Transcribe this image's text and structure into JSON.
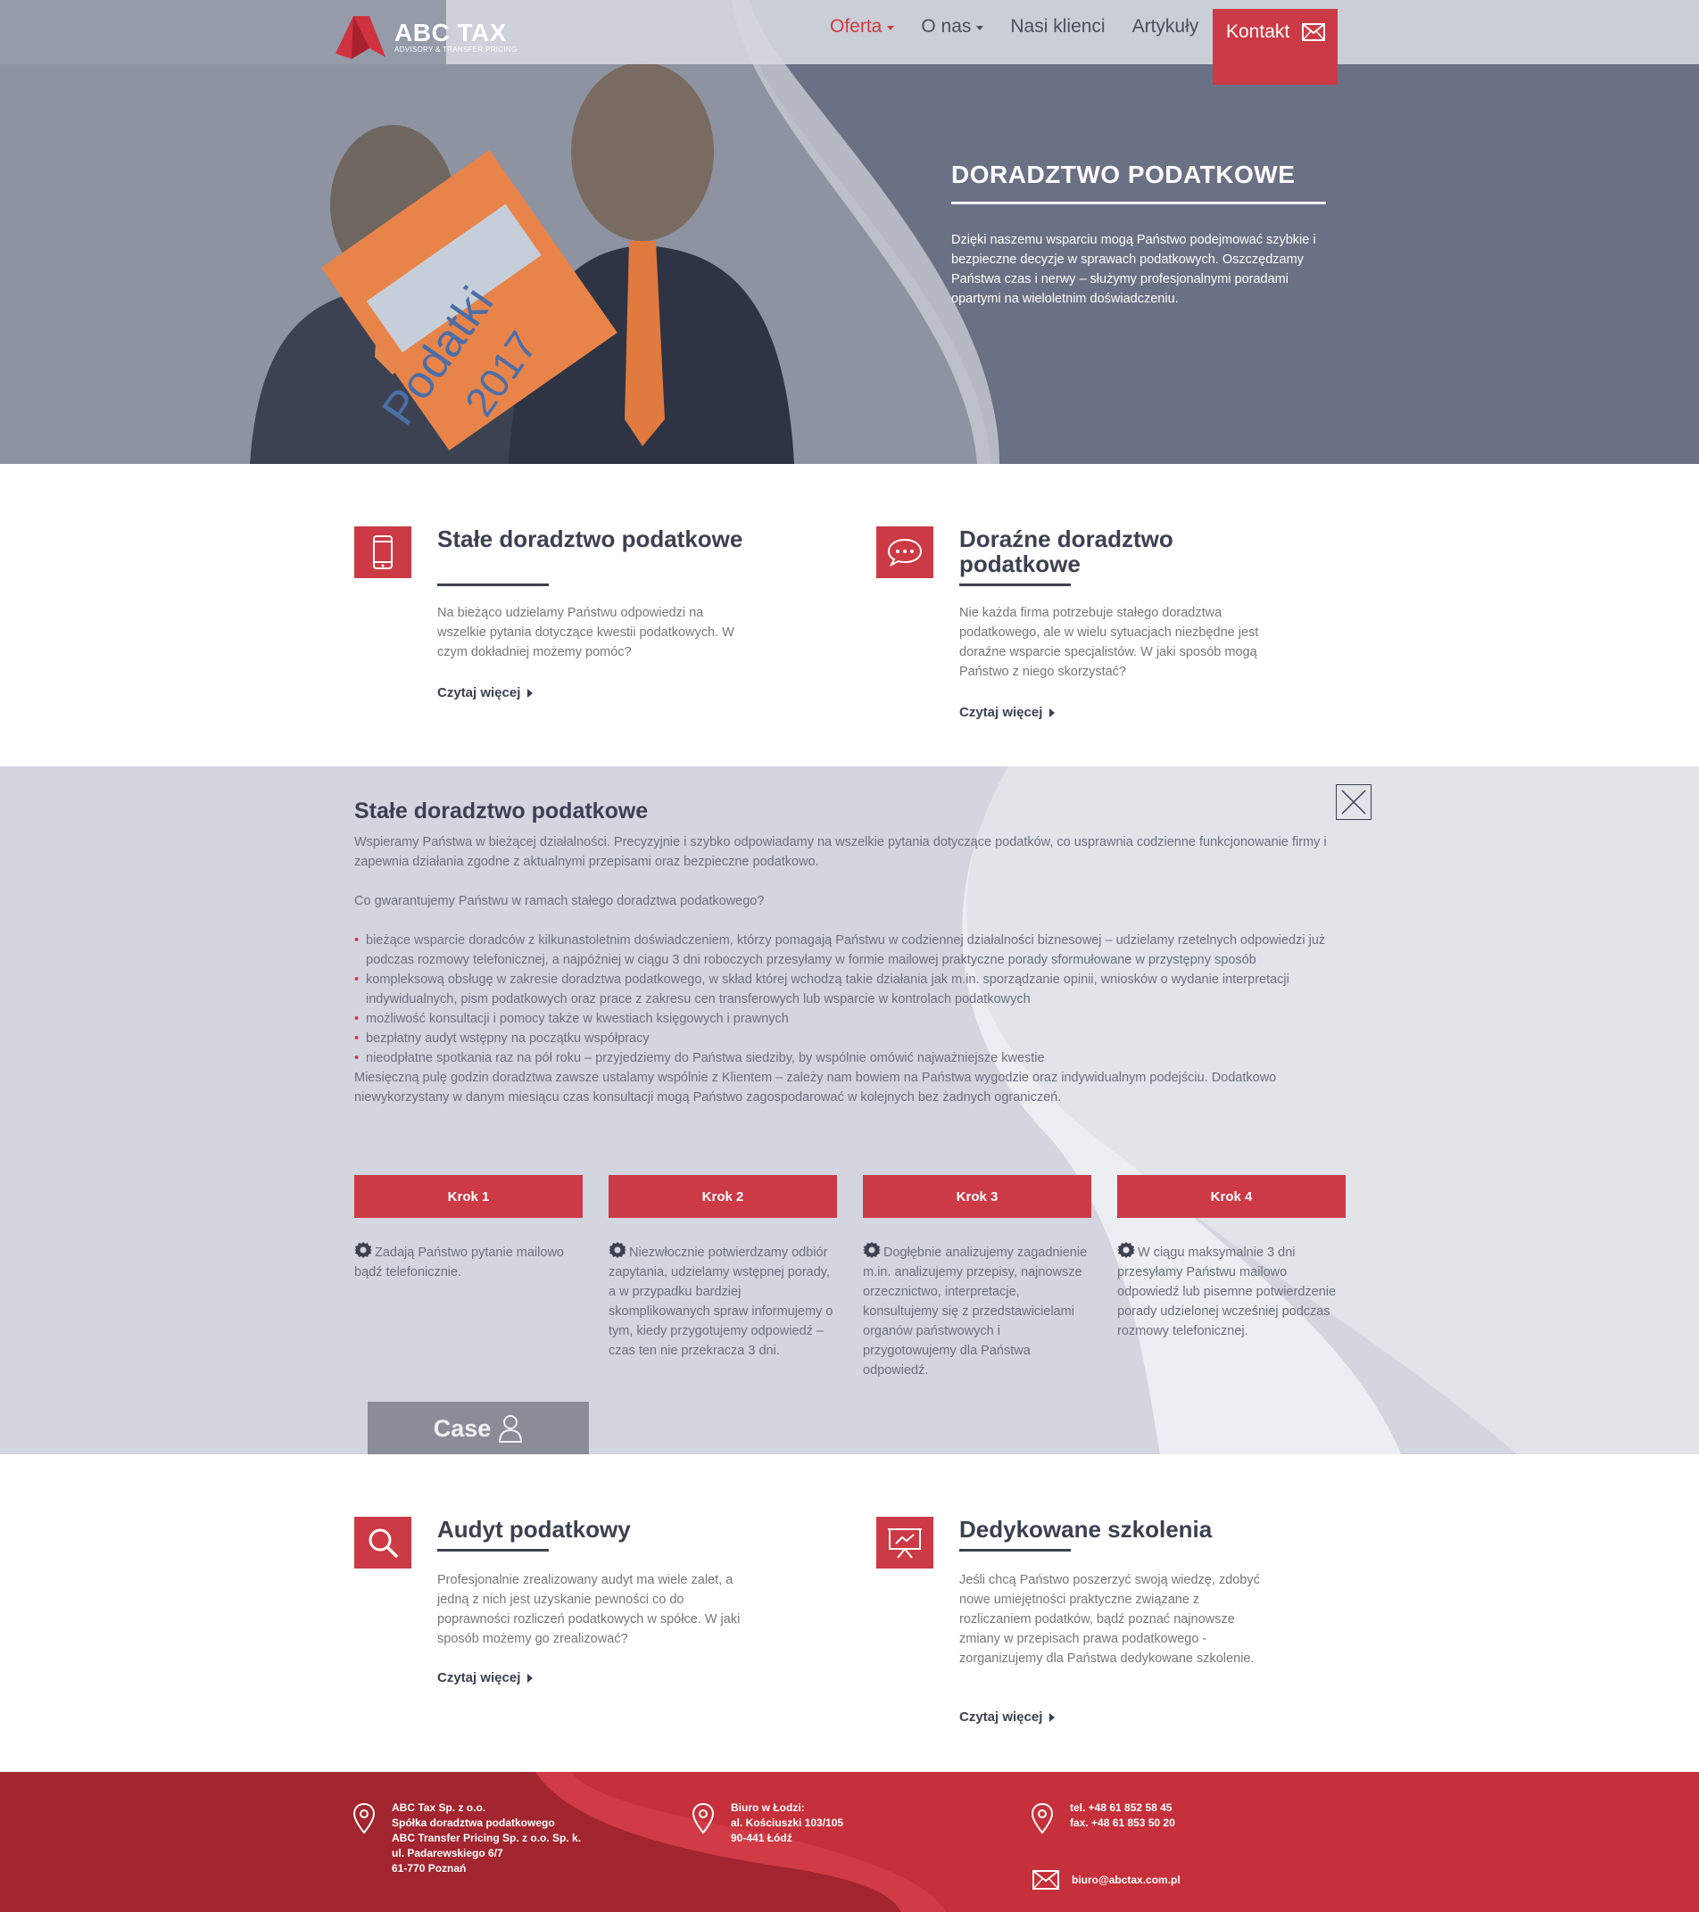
{
  "brand": {
    "name": "ABC TAX",
    "tagline": "ADVISORY & TRANSFER PRICING",
    "accent": "#cc3a45",
    "dark": "#3c4150"
  },
  "nav": {
    "items": [
      {
        "label": "Oferta",
        "dropdown": true,
        "active": true
      },
      {
        "label": "O nas",
        "dropdown": true,
        "active": false
      },
      {
        "label": "Nasi klienci",
        "dropdown": false,
        "active": false
      },
      {
        "label": "Artykuły",
        "dropdown": false,
        "active": false
      }
    ],
    "contact_label": "Kontakt"
  },
  "hero": {
    "book_title": "Podatki",
    "book_year": "2017",
    "title": "DORADZTWO PODATKOWE",
    "text": "Dzięki naszemu wsparciu mogą Państwo podejmować szybkie i bezpieczne decyzje w sprawach podatkowych. Oszczędzamy Państwa czas i nerwy – służymy profesjonalnymi poradami opartymi na wieloletnim doświadczeniu."
  },
  "services": [
    {
      "icon": "phone-icon",
      "title": "Stałe doradztwo podatkowe",
      "text": "Na bieżąco udzielamy Państwu odpowiedzi na wszelkie pytania dotyczące kwestii podatkowych. W czym dokładniej możemy pomóc?",
      "more": "Czytaj więcej"
    },
    {
      "icon": "chat-bubble-icon",
      "title": "Doraźne doradztwo podatkowe",
      "text": "Nie każda firma potrzebuje stałego doradztwa podatkowego, ale w wielu sytuacjach niezbędne jest doraźne wsparcie specjalistów. W jaki sposób mogą Państwo z niego skorzystać?",
      "more": "Czytaj więcej"
    },
    {
      "icon": "magnifier-icon",
      "title": "Audyt podatkowy",
      "text": "Profesjonalnie zrealizowany audyt ma wiele zalet, a jedną z nich jest uzyskanie pewności co do poprawności rozliczeń podatkowych w spółce. W jaki sposób możemy go zrealizować?",
      "more": "Czytaj więcej"
    },
    {
      "icon": "presentation-board-icon",
      "title": "Dedykowane szkolenia",
      "text": "Jeśli chcą Państwo poszerzyć swoją wiedzę, zdobyć nowe umiejętności praktyczne związane z rozliczaniem podatków, bądź poznać najnowsze zmiany w przepisach prawa podatkowego - zorganizujemy dla Państwa dedykowane szkolenie.",
      "more": "Czytaj więcej"
    }
  ],
  "panel": {
    "title": "Stałe doradztwo podatkowe",
    "intro": "Wspieramy Państwa w bieżącej działalności. Precyzyjnie i szybko odpowiadamy na wszelkie pytania dotyczące podatków, co usprawnia codzienne funkcjonowanie firmy i zapewnia działania zgodne z aktualnymi przepisami oraz bezpieczne podatkowo.",
    "question": "Co gwarantujemy Państwu w ramach stałego doradztwa podatkowego?",
    "bullets": [
      "bieżące wsparcie doradców z kilkunastoletnim doświadczeniem, którzy pomagają Państwu w codziennej działalności biznesowej – udzielamy rzetelnych odpowiedzi już podczas rozmowy telefonicznej, a najpóźniej w ciągu 3 dni roboczych przesyłamy w formie mailowej praktyczne porady sformułowane w przystępny sposób",
      "kompleksową obsługę w zakresie doradztwa podatkowego, w skład której wchodzą takie działania jak m.in. sporządzanie opinii, wniosków o wydanie interpretacji indywidualnych, pism podatkowych oraz prace z zakresu cen transferowych lub wsparcie w kontrolach podatkowych",
      "możliwość konsultacji i pomocy także w kwestiach księgowych i prawnych",
      "bezpłatny audyt wstępny na początku współpracy",
      "nieodpłatne spotkania raz na pół roku – przyjedziemy do Państwa siedziby, by wspólnie omówić najważniejsze kwestie"
    ],
    "outro": "Miesięczną pulę godzin doradztwa zawsze ustalamy wspólnie z Klientem – zależy nam bowiem na Państwa wygodzie oraz indywidualnym podejściu. Dodatkowo niewykorzystany w danym miesiącu czas konsultacji mogą Państwo zagospodarować w kolejnych bez żadnych ograniczeń.",
    "steps": [
      {
        "label": "Krok 1",
        "text": "Zadają Państwo pytanie mailowo bądź telefonicznie."
      },
      {
        "label": "Krok 2",
        "text": "Niezwłocznie potwierdzamy odbiór zapytania, udzielamy wstępnej porady, a w przypadku bardziej skomplikowanych spraw informujemy o tym, kiedy przygotujemy odpowiedź – czas ten nie przekracza 3 dni."
      },
      {
        "label": "Krok 3",
        "text": "Dogłębnie analizujemy zagadnienie m.in. analizujemy przepisy, najnowsze orzecznictwo, interpretacje, konsultujemy się z przedstawicielami organów państwowych i przygotowujemy dla Państwa odpowiedź."
      },
      {
        "label": "Krok 4",
        "text": "W ciągu maksymalnie 3 dni przesyłamy Państwu mailowo odpowiedź lub pisemne potwierdzenie porady udzielonej wcześniej podczas rozmowy telefonicznej."
      }
    ],
    "case_label": "Case"
  },
  "footer": {
    "company": [
      "ABC Tax Sp. z o.o.",
      "Spółka doradztwa podatkowego",
      "ABC Transfer Pricing Sp. z o.o. Sp. k.",
      "ul. Padarewskiego 6/7",
      "61-770 Poznań"
    ],
    "office": [
      "Biuro w Łodzi:",
      "al. Kościuszki 103/105",
      "90-441 Łódź"
    ],
    "phones": [
      "tel. +48 61 852 58 45",
      "fax. +48 61 853 50 20"
    ],
    "email": "biuro@abctax.com.pl"
  }
}
